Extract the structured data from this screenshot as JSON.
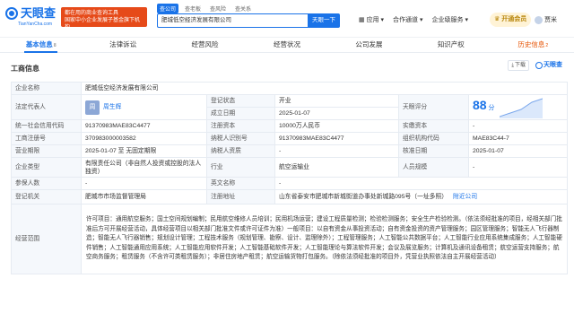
{
  "header": {
    "logo_text": "天眼查",
    "logo_url": "TianYanCha.com",
    "promo_lines": [
      "都在用的商业查询工具",
      "国家中小企业发展子基金旗下机构"
    ],
    "search_tabs": [
      "查公司",
      "查老板",
      "查风险",
      "查关系"
    ],
    "search_value": "肥城低空经济发展有限公司",
    "search_button": "天眼一下",
    "nav": [
      "应用 ▾",
      "合作通道 ▾",
      "企业级服务 ▾",
      "⊘ 开通会员 ▾"
    ],
    "vip": "开通会员",
    "user": "贾米"
  },
  "tabs": [
    {
      "label": "基本信息",
      "count": "8",
      "active": true
    },
    {
      "label": "法律诉讼",
      "count": ""
    },
    {
      "label": "经营风险",
      "count": ""
    },
    {
      "label": "经营状况",
      "count": ""
    },
    {
      "label": "公司发展",
      "count": ""
    },
    {
      "label": "知识产权",
      "count": ""
    },
    {
      "label": "历史信息",
      "count": "2",
      "hot": true
    }
  ],
  "card": {
    "title": "工商信息",
    "download_label": "下载",
    "tyc_label": "天眼查"
  },
  "rows": {
    "company_name_label": "企业名称",
    "company_name": "肥城低空经济发展有限公司",
    "legal_rep_label": "法定代表人",
    "legal_rep_avatar": "周",
    "legal_rep": "周生辉",
    "reg_status_label": "登记状态",
    "reg_status": "开业",
    "tianyan_score_label": "天眼评分",
    "tianyan_score": "88",
    "tianyan_score_unit": "分",
    "est_date_label": "成立日期",
    "est_date": "2025-01-07",
    "credit_code_label": "统一社会信用代码",
    "credit_code": "91370983MAE83C4477",
    "reg_capital_label": "注册资本",
    "reg_capital": "10000万人民币",
    "paid_capital_label": "实缴资本",
    "paid_capital": "-",
    "biz_reg_no_label": "工商注册号",
    "biz_reg_no": "370983000003582",
    "taxpayer_id_label": "纳税人识别号",
    "taxpayer_id": "91370983MAE83C4477",
    "org_code_label": "组织机构代码",
    "org_code": "MAE83C44-7",
    "term_label": "营业期限",
    "term": "2025-01-07 至 无固定期限",
    "taxpayer_qual_label": "纳税人资质",
    "taxpayer_qual": "-",
    "approval_date_label": "核准日期",
    "approval_date": "2025-01-07",
    "company_type_label": "企业类型",
    "company_type": "有限责任公司（非自然人投资或控股的法人独资）",
    "industry_label": "行业",
    "industry": "航空运输业",
    "staff_size_label": "人员规模",
    "staff_size": "-",
    "insured_label": "参保人数",
    "insured": "-",
    "english_name_label": "英文名称",
    "english_name": "-",
    "reg_authority_label": "登记机关",
    "reg_authority": "肥城市市场监督管理局",
    "address_label": "注册地址",
    "address": "山东省泰安市肥城市新城街道办事处新城路095号（一址多照）",
    "nearby_label": "附近公司",
    "scope_label": "经营范围",
    "scope": "许可项目：通用航空服务；国土空间规划编制；民用航空维修人员培训；民用机场运营；建设工程质量检测；检验检测服务；安全生产检验检测。（依法须经批准的项目，经相关部门批准后方可开展经营活动，具体经营项目以相关部门批准文件或许可证件为准）一般项目：以自有资金从事投资活动；自有资金投资的资产管理服务；园区管理服务；智能无人飞行器制造；智能无人飞行器销售；规划设计管理；工程技术服务（规划管理、勘察、设计、监理除外）；工程管理服务；人工智能公共数据平台；人工智能行业应用系统集成服务；人工智能硬件销售；人工智能通用应用系统；人工智能应用软件开发；人工智能基础软件开发；人工智能理论与算法软件开发；会议及展览服务；计算机及通讯设备租赁；航空运营支持服务；航空商务服务；租赁服务（不含许可类租赁服务）；非居住房地产租赁；航空运输货物打包服务。（除依法须经批准的项目外，凭营业执照依法自主开展经营活动）"
  }
}
